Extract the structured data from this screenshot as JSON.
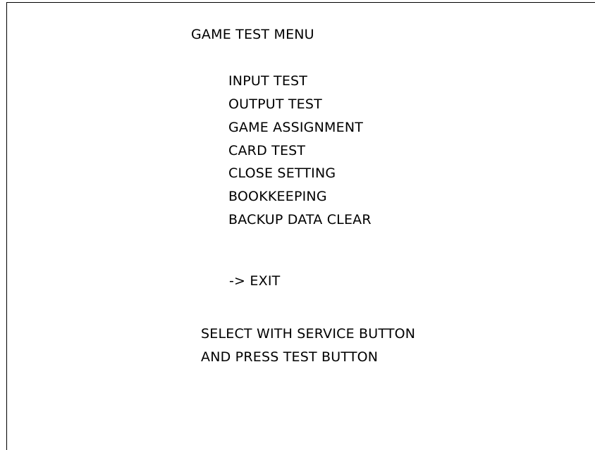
{
  "screen": {
    "title": "GAME TEST MENU",
    "menu_items": [
      {
        "label": "INPUT TEST"
      },
      {
        "label": "OUTPUT TEST"
      },
      {
        "label": "GAME ASSIGNMENT"
      },
      {
        "label": "CARD TEST"
      },
      {
        "label": "CLOSE SETTING"
      },
      {
        "label": "BOOKKEEPING"
      },
      {
        "label": "BACKUP DATA CLEAR"
      }
    ],
    "exit_item": {
      "cursor": "->",
      "label": "EXIT"
    },
    "instructions": {
      "line1": "SELECT WITH SERVICE BUTTON",
      "line2": "AND PRESS TEST BUTTON"
    }
  }
}
